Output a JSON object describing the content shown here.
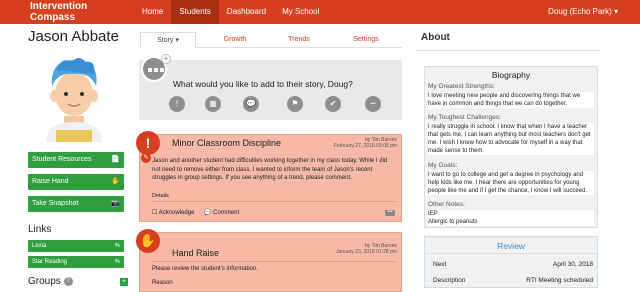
{
  "topbar": {
    "brand": "Intervention Compass",
    "nav": [
      "Home",
      "Students",
      "Dashboard",
      "My School"
    ],
    "active_nav": "Students",
    "user": "Doug (Echo Park) ▾"
  },
  "student": {
    "name": "Jason Abbate",
    "actions": [
      {
        "label": "Student Resources",
        "icon": "document-icon",
        "glyph": "📄"
      },
      {
        "label": "Raise Hand",
        "icon": "hand-icon",
        "glyph": "✋"
      },
      {
        "label": "Take Snapshot",
        "icon": "camera-icon",
        "glyph": "📷"
      }
    ],
    "links_title": "Links",
    "links": [
      {
        "label": "Lexia",
        "glyph": "%"
      },
      {
        "label": "Star Reading",
        "glyph": "%"
      }
    ],
    "groups_title": "Groups",
    "groups_count_glyph": "?",
    "groups_add_glyph": "+"
  },
  "tabs": {
    "items": [
      "Story ▾",
      "Growth",
      "Trends",
      "Settings"
    ],
    "active": "Story ▾"
  },
  "prompt": {
    "text": "What would you like to add to their story, Doug?",
    "plus_glyph": "+",
    "icons": [
      {
        "name": "alert-icon",
        "glyph": "!"
      },
      {
        "name": "calendar-icon",
        "glyph": "▦"
      },
      {
        "name": "chat-icon",
        "glyph": "💬"
      },
      {
        "name": "flag-icon",
        "glyph": "⚑"
      },
      {
        "name": "check-icon",
        "glyph": "✔"
      },
      {
        "name": "more-icon",
        "glyph": "•••"
      }
    ]
  },
  "cards": [
    {
      "title": "Minor Classroom Discipline",
      "by": "by Tim Barnes",
      "date": "February 27, 2018 03:05 pm",
      "badge_glyph": "!",
      "sub_glyph": "✎",
      "body": "Jason and another student had difficulties working together in my class today. While I did not need to remove either from class, I wanted to inform the team of Jason's recent struggles in group settings. If you see anything of a trend, please comment.",
      "details_label": "Details",
      "acknowledge_label": "☐ Acknowledge",
      "comment_label": "💬 Comment",
      "more_glyph": "•••"
    },
    {
      "title": "Hand Raise",
      "by": "by Tim Barnes",
      "date": "January 23, 2018 01:28 pm",
      "badge_glyph": "✋",
      "body": "Please review the student's information.",
      "reason_label": "Reason"
    }
  ],
  "about": {
    "title": "About",
    "bio_title": "Biography",
    "sections": [
      {
        "label": "My Greatest Strengths:",
        "text": "I love meeting new people and discovering things that we have in common and things that we can do together."
      },
      {
        "label": "My Toughest Challenges:",
        "text": "I really struggle in school. I know that when I have a teacher that gets me, I can learn anything but most teachers don't get me. I wish I knew how to advocate for myself in a way that made sense to them."
      },
      {
        "label": "My Goals:",
        "text": "I want to go to college and get a degree in psychology and help kids like me. I hear there are opportunities for young people like me and if I get the chance, I know I will succeed."
      },
      {
        "label": "Other Notes:",
        "text": "IEP\nAllergic to peanuts"
      }
    ],
    "review_title": "Review",
    "review_rows": [
      {
        "label": "Next",
        "value": "April 30, 2018"
      },
      {
        "label": "Description",
        "value": "RTI Meeting scheduled"
      }
    ]
  },
  "colors": {
    "brand": "#d7401f",
    "active_nav": "#a82f12",
    "green": "#2f9e3e",
    "card": "#f6b9a7",
    "review_blue": "#3a8fc8"
  }
}
